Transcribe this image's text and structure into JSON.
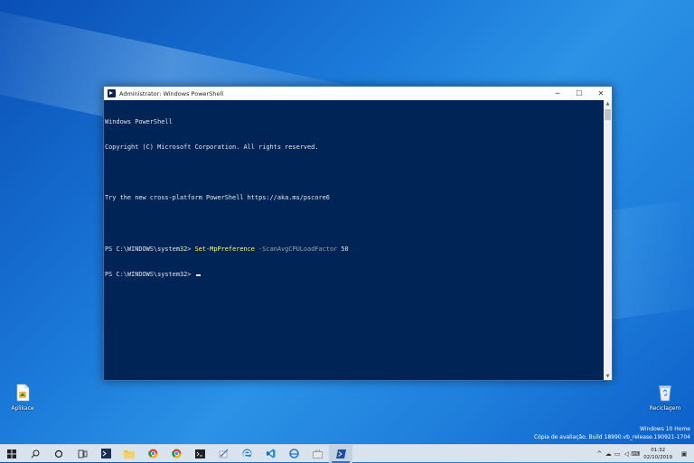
{
  "window": {
    "title": "Administrator: Windows PowerShell",
    "minimize": "─",
    "maximize": "☐",
    "close": "✕"
  },
  "console": {
    "line1": "Windows PowerShell",
    "line2": "Copyright (C) Microsoft Corporation. All rights reserved.",
    "line3": "Try the new cross-platform PowerShell https://aka.ms/pscore6",
    "prompt": "PS C:\\WINDOWS\\system32> ",
    "command": "Set-MpPreference",
    "param": " -ScanAvgCPULoadFactor",
    "value": " 50"
  },
  "desktop": {
    "icon_left_label": "Aplikace",
    "icon_right_label": "Reciclagem"
  },
  "watermark": {
    "line1": "Windows 10 Home",
    "line2": "Cópia de avaliação. Build 18990.vb_release.190921-1704"
  },
  "tray": {
    "time": "01:32",
    "date": "02/10/2019"
  },
  "colors": {
    "console_bg": "#012456",
    "command": "#ffff66",
    "parameter": "#9aa0a6"
  }
}
